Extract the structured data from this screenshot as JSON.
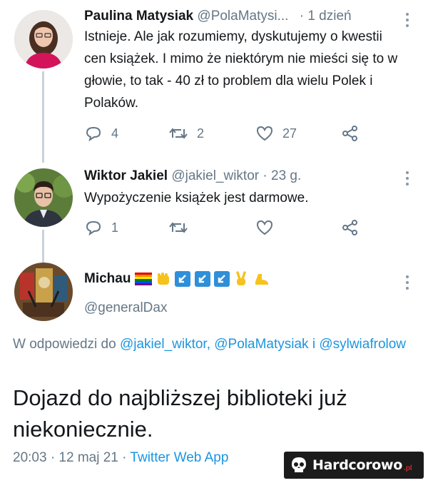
{
  "tweets": [
    {
      "name": "Paulina Matysiak",
      "handle": "@PolaMatysi...",
      "time": "· 1 dzień",
      "text": "Istnieje. Ale jak rozumiemy, dyskutujemy o kwestii cen książek. I mimo że niektórym nie mieści się to w głowie, to tak - 40 zł to problem dla wielu Polek i Polaków.",
      "replies": "4",
      "retweets": "2",
      "likes": "27"
    },
    {
      "name": "Wiktor Jakiel",
      "handle": "@jakiel_wiktor",
      "time": "· 23 g.",
      "text": "Wypożyczenie książek jest darmowe.",
      "replies": "1",
      "retweets": "",
      "likes": ""
    }
  ],
  "main_tweet": {
    "name": "Michau",
    "handle": "@generalDax",
    "reply_prefix": "W odpowiedzi do",
    "reply_users": "@jakiel_wiktor, @PolaMatysiak i @sylwiafrolow",
    "text": "Dojazd do najbliższej biblioteki już niekoniecznie.",
    "time": "20:03",
    "date": "· 12 maj 21 ·",
    "source": "Twitter Web App"
  },
  "watermark": {
    "text": "Hardcorowo",
    "suffix": ".pl"
  },
  "colors": {
    "link": "#1b95e0",
    "muted": "#657786",
    "icon": "#657786",
    "thread_line": "#c9d3db"
  },
  "icons": [
    "reply-icon",
    "retweet-icon",
    "like-icon",
    "share-icon",
    "more-icon",
    "rainbow-flag-icon",
    "fist-icon",
    "arrow-badge-icon",
    "victory-hand-icon",
    "boot-icon",
    "skull-icon"
  ]
}
